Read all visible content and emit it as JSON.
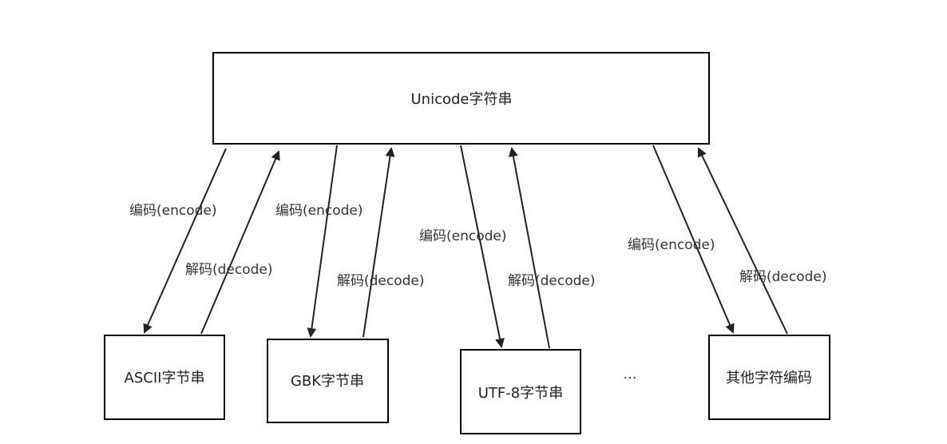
{
  "top_node": {
    "label": "Unicode字符串"
  },
  "bottom_nodes": [
    {
      "id": "ascii",
      "label": "ASCII字节串"
    },
    {
      "id": "gbk",
      "label": "GBK字节串"
    },
    {
      "id": "utf8",
      "label": "UTF-8字节串"
    },
    {
      "id": "other",
      "label": "其他字符编码"
    }
  ],
  "ellipsis": "…",
  "edge_labels": {
    "encode": "编码(encode)",
    "decode": "解码(decode)"
  },
  "colors": {
    "line": "#222222",
    "box_border": "#000000",
    "text": "#333333",
    "background": "#ffffff"
  }
}
